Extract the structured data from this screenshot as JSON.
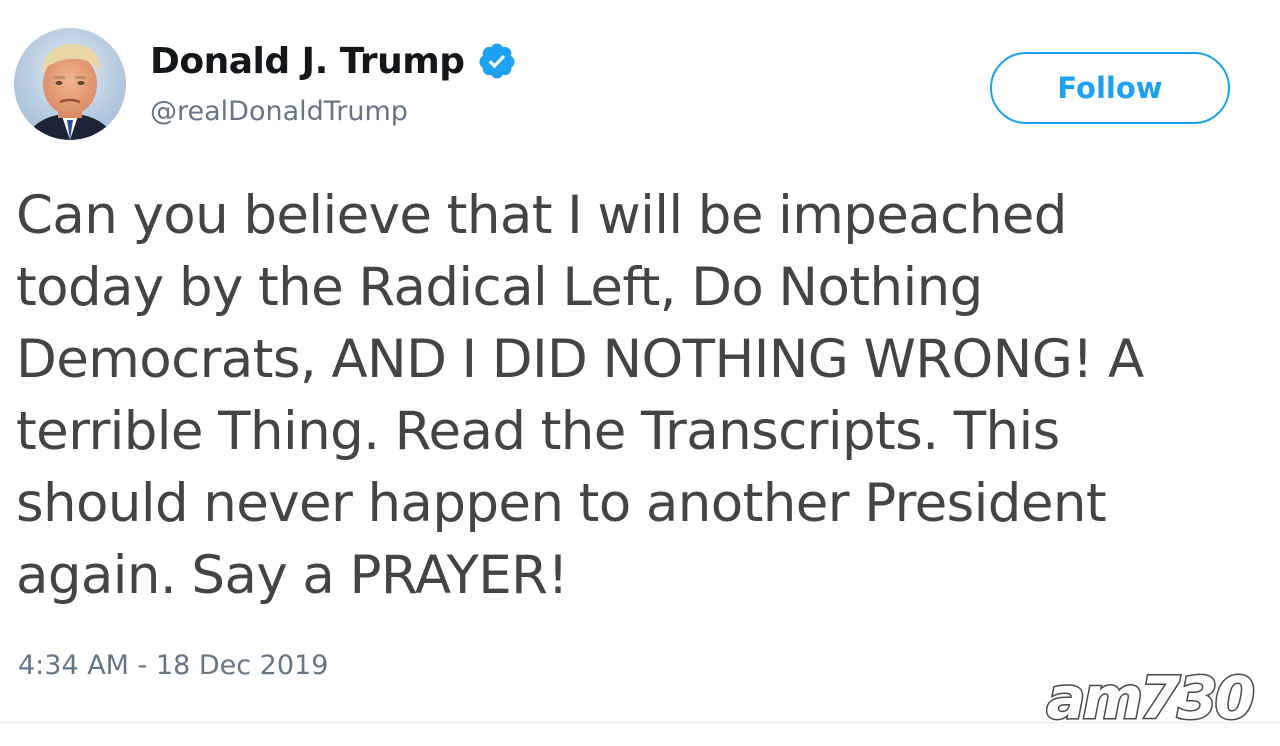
{
  "tweet": {
    "author": {
      "display_name": "Donald J. Trump",
      "handle": "@realDonaldTrump",
      "verified": true,
      "avatar_icon": "profile-photo"
    },
    "follow_label": "Follow",
    "text_lines": [
      "Can you believe that I will be impeached",
      "today by the Radical Left, Do Nothing",
      "Democrats, AND I DID NOTHING WRONG! A",
      "terrible Thing. Read the Transcripts. This",
      "should never happen to another President",
      "again. Say a PRAYER!"
    ],
    "timestamp": "4:34 AM - 18 Dec 2019"
  },
  "watermark": {
    "text": "am730"
  },
  "colors": {
    "accent": "#1da1f2",
    "name_text": "#14171a",
    "body_text": "#444444",
    "secondary_text": "#657786",
    "divider": "#e6ecf0"
  }
}
